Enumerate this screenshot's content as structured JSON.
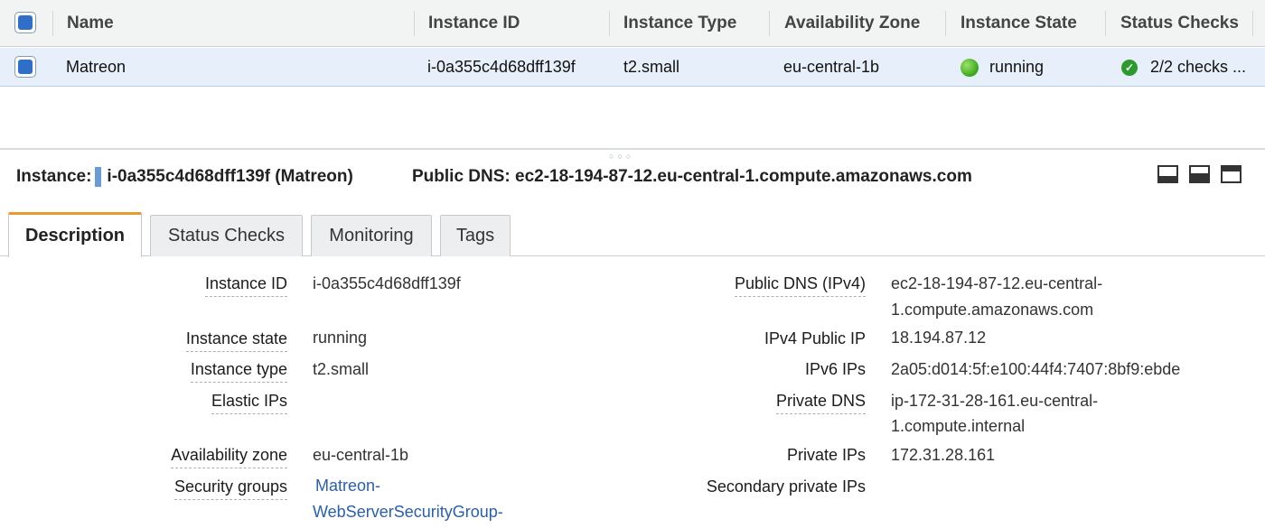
{
  "table": {
    "columns": [
      {
        "key": "name",
        "label": "Name",
        "sort": "asc"
      },
      {
        "key": "instance_id",
        "label": "Instance ID",
        "sort": "none"
      },
      {
        "key": "instance_type",
        "label": "Instance Type",
        "sort": "none"
      },
      {
        "key": "availability_zone",
        "label": "Availability Zone",
        "sort": "none"
      },
      {
        "key": "instance_state",
        "label": "Instance State",
        "sort": "none"
      },
      {
        "key": "status_checks",
        "label": "Status Checks",
        "sort": "none"
      }
    ],
    "rows": [
      {
        "selected": true,
        "name": "Matreon",
        "instance_id": "i-0a355c4d68dff139f",
        "instance_type": "t2.small",
        "availability_zone": "eu-central-1b",
        "instance_state": "running",
        "status_checks": "2/2 checks ..."
      }
    ]
  },
  "details": {
    "instance_label": "Instance:",
    "instance_value": "i-0a355c4d68dff139f (Matreon)",
    "dns_label": "Public DNS:",
    "dns_value": "ec2-18-194-87-12.eu-central-1.compute.amazonaws.com"
  },
  "tabs": [
    {
      "label": "Description",
      "active": true
    },
    {
      "label": "Status Checks",
      "active": false
    },
    {
      "label": "Monitoring",
      "active": false
    },
    {
      "label": "Tags",
      "active": false
    }
  ],
  "description": {
    "left": [
      {
        "label": "Instance ID",
        "value": "i-0a355c4d68dff139f"
      },
      {
        "label": "Instance state",
        "value": "running"
      },
      {
        "label": "Instance type",
        "value": "t2.small"
      },
      {
        "label": "Elastic IPs",
        "value": ""
      },
      {
        "label": "Availability zone",
        "value": "eu-central-1b"
      },
      {
        "label": "Security groups",
        "value_line1": "Matreon-",
        "value_line2": "WebServerSecurityGroup-"
      }
    ],
    "right": [
      {
        "label": "Public DNS (IPv4)",
        "value_line1": "ec2-18-194-87-12.eu-central-",
        "value_line2": "1.compute.amazonaws.com"
      },
      {
        "label": "IPv4 Public IP",
        "value": "18.194.87.12"
      },
      {
        "label": "IPv6 IPs",
        "value": "2a05:d014:5f:e100:44f4:7407:8bf9:ebde"
      },
      {
        "label": "Private DNS",
        "value_line1": "ip-172-31-28-161.eu-central-",
        "value_line2": "1.compute.internal"
      },
      {
        "label": "Private IPs",
        "value": "172.31.28.161"
      },
      {
        "label": "Secondary private IPs",
        "value": ""
      }
    ]
  },
  "colors": {
    "accent_tab": "#e89a2f",
    "selection": "#e7f0fa",
    "running": "#3aa51a",
    "link": "#2a5fad"
  }
}
